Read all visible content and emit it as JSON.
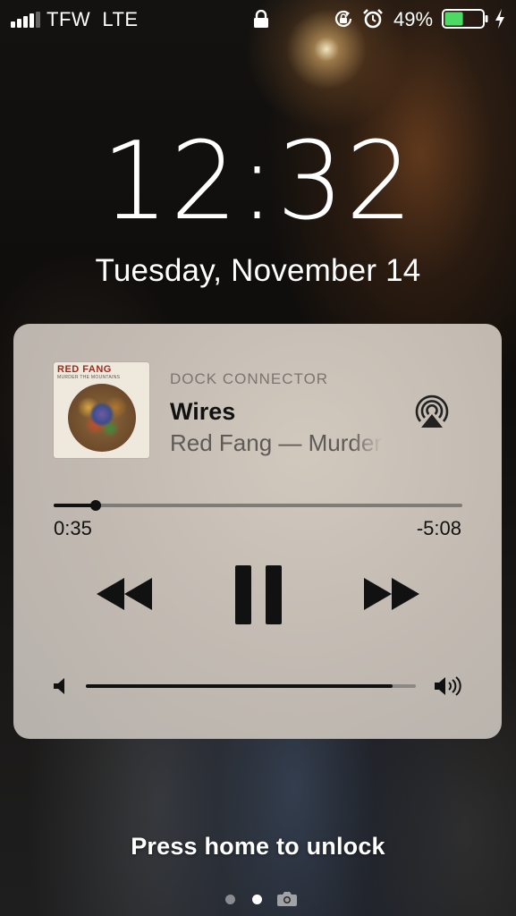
{
  "status_bar": {
    "carrier": "TFW",
    "network": "LTE",
    "battery_percent": "49%",
    "battery_level": 0.49,
    "battery_color": "#4cd964",
    "icons": [
      "signal-icon",
      "lock-icon",
      "rotation-lock-icon",
      "alarm-icon",
      "battery-icon",
      "charging-icon"
    ]
  },
  "lock_screen": {
    "time": "12:32",
    "date": "Tuesday, November 14",
    "unlock_hint": "Press home to unlock",
    "page_dots": {
      "count": 2,
      "active": 1,
      "trailing_icon": "camera-icon"
    }
  },
  "player": {
    "source": "DOCK CONNECTOR",
    "title": "Wires",
    "artist_album": "Red Fang — Murder the Mountains",
    "album_art": {
      "band_text": "RED FANG",
      "album_text": "MURDER THE MOUNTAINS"
    },
    "elapsed": "0:35",
    "remaining": "-5:08",
    "progress": 0.103,
    "volume": 0.93,
    "controls": [
      "rewind-icon",
      "pause-icon",
      "fast-forward-icon",
      "airplay-icon"
    ]
  }
}
